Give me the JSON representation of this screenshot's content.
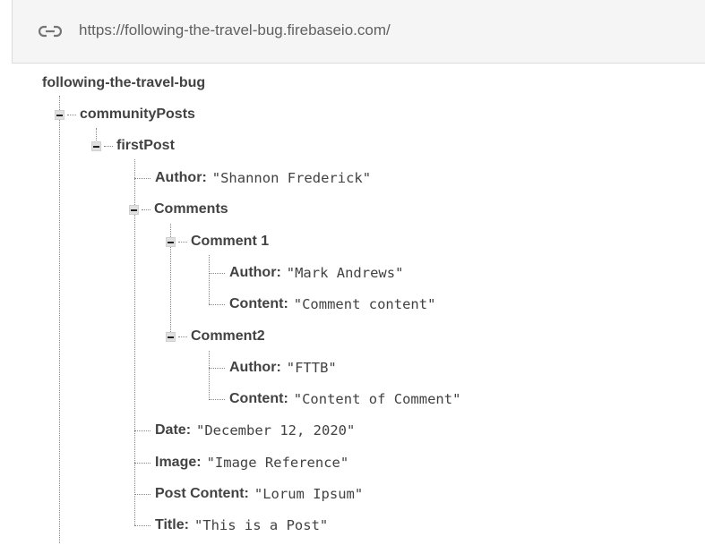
{
  "url_bar": {
    "icon": "link-icon",
    "url": "https://following-the-travel-bug.firebaseio.com/"
  },
  "tree": {
    "root": "following-the-travel-bug",
    "communityPosts": "communityPosts",
    "firstPost": "firstPost",
    "author_key": "Author",
    "author_val": "\"Shannon Frederick\"",
    "comments_key": "Comments",
    "comment1_key": "Comment 1",
    "c1_author_key": "Author",
    "c1_author_val": "\"Mark Andrews\"",
    "c1_content_key": "Content",
    "c1_content_val": "\"Comment content\"",
    "comment2_key": "Comment2",
    "c2_author_key": "Author",
    "c2_author_val": "\"FTTB\"",
    "c2_content_key": "Content",
    "c2_content_val": "\"Content of Comment\"",
    "date_key": "Date",
    "date_val": "\"December 12, 2020\"",
    "image_key": "Image",
    "image_val": "\"Image Reference\"",
    "post_content_key": "Post Content",
    "post_content_val": "\"Lorum Ipsum\"",
    "title_key": "Title",
    "title_val": "\"This is a Post\""
  }
}
